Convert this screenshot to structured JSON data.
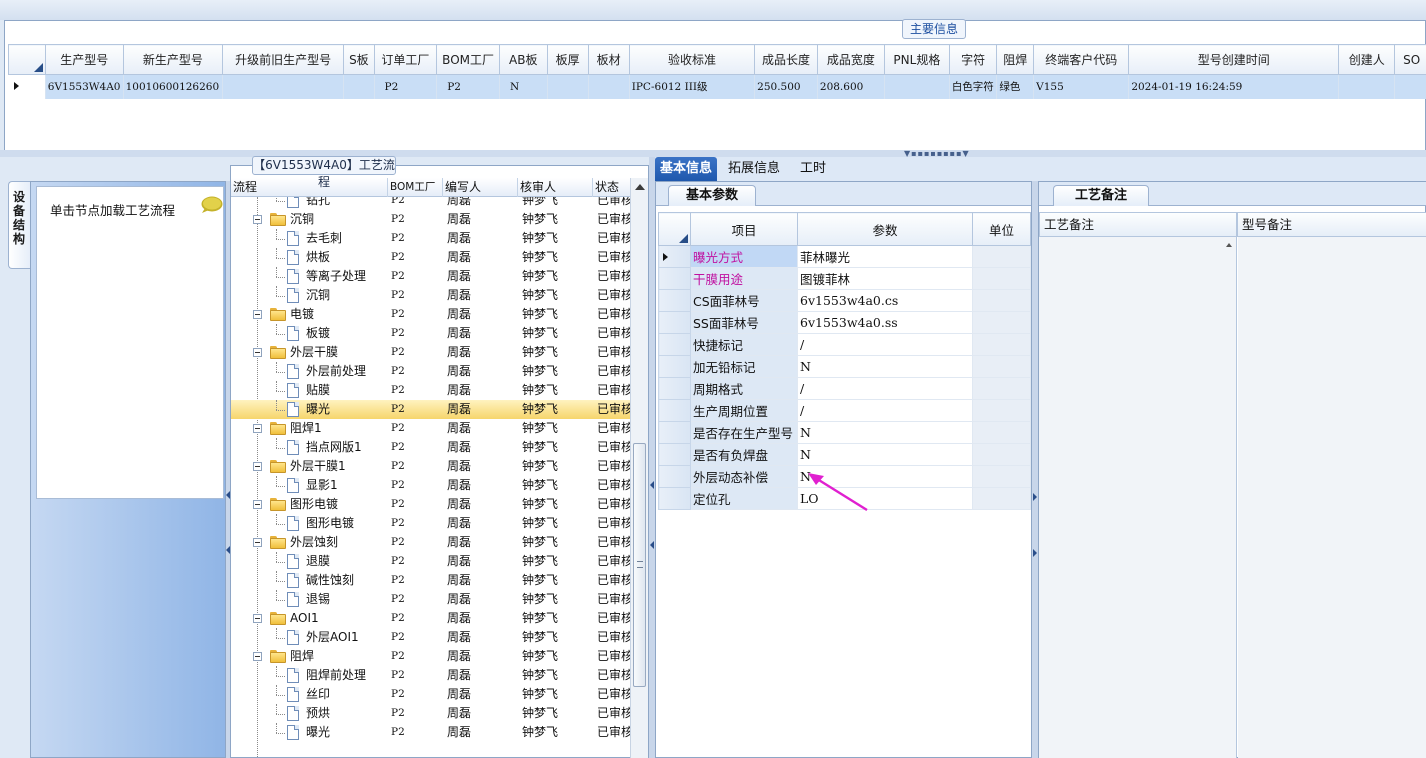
{
  "main_info": {
    "title": "主要信息",
    "columns": [
      "生产型号",
      "新生产型号",
      "升级前旧生产型号",
      "S板",
      "订单工厂",
      "BOM工厂",
      "AB板",
      "板厚",
      "板材",
      "验收标准",
      "成品长度",
      "成品宽度",
      "PNL规格",
      "字符",
      "阻焊",
      "终端客户代码",
      "型号创建时间",
      "创建人",
      "SO"
    ],
    "row": [
      "6V1553W4A0",
      "10010600126260",
      "",
      "",
      "P2",
      "P2",
      "N",
      "",
      "",
      "IPC-6012 III级",
      "250.500",
      "208.600",
      "",
      "白色字符",
      "绿色",
      "V155",
      "2024-01-19 16:24:59",
      "",
      ""
    ]
  },
  "left": {
    "vertical_tab": "设备结构",
    "hint": "单击节点加载工艺流程"
  },
  "process": {
    "title": "【6V1553W4A0】工艺流程",
    "columns": [
      "流程",
      "BOM工厂",
      "编写人",
      "核审人",
      "状态"
    ],
    "first_row_label": "钻孔",
    "rows": [
      {
        "name": "钻孔",
        "level": 2,
        "bom": "P2",
        "author": "周磊",
        "reviewer": "钟梦飞",
        "status": "已审核"
      },
      {
        "name": "沉铜",
        "level": 1,
        "bom": "P2",
        "author": "周磊",
        "reviewer": "钟梦飞",
        "status": "已审核"
      },
      {
        "name": "去毛刺",
        "level": 2,
        "bom": "P2",
        "author": "周磊",
        "reviewer": "钟梦飞",
        "status": "已审核"
      },
      {
        "name": "烘板",
        "level": 2,
        "bom": "P2",
        "author": "周磊",
        "reviewer": "钟梦飞",
        "status": "已审核"
      },
      {
        "name": "等离子处理",
        "level": 2,
        "bom": "P2",
        "author": "周磊",
        "reviewer": "钟梦飞",
        "status": "已审核"
      },
      {
        "name": "沉铜",
        "level": 2,
        "bom": "P2",
        "author": "周磊",
        "reviewer": "钟梦飞",
        "status": "已审核"
      },
      {
        "name": "电镀",
        "level": 1,
        "bom": "P2",
        "author": "周磊",
        "reviewer": "钟梦飞",
        "status": "已审核"
      },
      {
        "name": "板镀",
        "level": 2,
        "bom": "P2",
        "author": "周磊",
        "reviewer": "钟梦飞",
        "status": "已审核"
      },
      {
        "name": "外层干膜",
        "level": 1,
        "bom": "P2",
        "author": "周磊",
        "reviewer": "钟梦飞",
        "status": "已审核"
      },
      {
        "name": "外层前处理",
        "level": 2,
        "bom": "P2",
        "author": "周磊",
        "reviewer": "钟梦飞",
        "status": "已审核"
      },
      {
        "name": "贴膜",
        "level": 2,
        "bom": "P2",
        "author": "周磊",
        "reviewer": "钟梦飞",
        "status": "已审核"
      },
      {
        "name": "曝光",
        "level": 2,
        "bom": "P2",
        "author": "周磊",
        "reviewer": "钟梦飞",
        "status": "已审核",
        "selected": true
      },
      {
        "name": "阻焊1",
        "level": 1,
        "bom": "P2",
        "author": "周磊",
        "reviewer": "钟梦飞",
        "status": "已审核"
      },
      {
        "name": "挡点网版1",
        "level": 2,
        "bom": "P2",
        "author": "周磊",
        "reviewer": "钟梦飞",
        "status": "已审核"
      },
      {
        "name": "外层干膜1",
        "level": 1,
        "bom": "P2",
        "author": "周磊",
        "reviewer": "钟梦飞",
        "status": "已审核"
      },
      {
        "name": "显影1",
        "level": 2,
        "bom": "P2",
        "author": "周磊",
        "reviewer": "钟梦飞",
        "status": "已审核"
      },
      {
        "name": "图形电镀",
        "level": 1,
        "bom": "P2",
        "author": "周磊",
        "reviewer": "钟梦飞",
        "status": "已审核"
      },
      {
        "name": "图形电镀",
        "level": 2,
        "bom": "P2",
        "author": "周磊",
        "reviewer": "钟梦飞",
        "status": "已审核"
      },
      {
        "name": "外层蚀刻",
        "level": 1,
        "bom": "P2",
        "author": "周磊",
        "reviewer": "钟梦飞",
        "status": "已审核"
      },
      {
        "name": "退膜",
        "level": 2,
        "bom": "P2",
        "author": "周磊",
        "reviewer": "钟梦飞",
        "status": "已审核"
      },
      {
        "name": "碱性蚀刻",
        "level": 2,
        "bom": "P2",
        "author": "周磊",
        "reviewer": "钟梦飞",
        "status": "已审核"
      },
      {
        "name": "退锡",
        "level": 2,
        "bom": "P2",
        "author": "周磊",
        "reviewer": "钟梦飞",
        "status": "已审核"
      },
      {
        "name": "AOI1",
        "level": 1,
        "bom": "P2",
        "author": "周磊",
        "reviewer": "钟梦飞",
        "status": "已审核"
      },
      {
        "name": "外层AOI1",
        "level": 2,
        "bom": "P2",
        "author": "周磊",
        "reviewer": "钟梦飞",
        "status": "已审核"
      },
      {
        "name": "阻焊",
        "level": 1,
        "bom": "P2",
        "author": "周磊",
        "reviewer": "钟梦飞",
        "status": "已审核"
      },
      {
        "name": "阻焊前处理",
        "level": 2,
        "bom": "P2",
        "author": "周磊",
        "reviewer": "钟梦飞",
        "status": "已审核"
      },
      {
        "name": "丝印",
        "level": 2,
        "bom": "P2",
        "author": "周磊",
        "reviewer": "钟梦飞",
        "status": "已审核"
      },
      {
        "name": "预烘",
        "level": 2,
        "bom": "P2",
        "author": "周磊",
        "reviewer": "钟梦飞",
        "status": "已审核"
      },
      {
        "name": "曝光",
        "level": 2,
        "bom": "P2",
        "author": "周磊",
        "reviewer": "钟梦飞",
        "status": "已审核"
      }
    ]
  },
  "top_tabs": [
    "基本信息",
    "拓展信息",
    "工时"
  ],
  "basic_params": {
    "tab": "基本参数",
    "columns": [
      "项目",
      "参数",
      "单位"
    ],
    "rows": [
      {
        "item": "曝光方式",
        "value": "菲林曝光",
        "unit": "",
        "highlight": true
      },
      {
        "item": "干膜用途",
        "value": "图镀菲林",
        "unit": "",
        "highlight": true
      },
      {
        "item": "CS面菲林号",
        "value": "6v1553w4a0.cs",
        "unit": ""
      },
      {
        "item": "SS面菲林号",
        "value": "6v1553w4a0.ss",
        "unit": ""
      },
      {
        "item": "快捷标记",
        "value": "/",
        "unit": ""
      },
      {
        "item": "加无铅标记",
        "value": "N",
        "unit": ""
      },
      {
        "item": "周期格式",
        "value": "/",
        "unit": ""
      },
      {
        "item": "生产周期位置",
        "value": "/",
        "unit": ""
      },
      {
        "item": "是否存在生产型号",
        "value": "N",
        "unit": ""
      },
      {
        "item": "是否有负焊盘",
        "value": "N",
        "unit": ""
      },
      {
        "item": "外层动态补偿",
        "value": "N",
        "unit": ""
      },
      {
        "item": "定位孔",
        "value": "LO",
        "unit": ""
      }
    ]
  },
  "remarks": {
    "tab": "工艺备注",
    "process_remark_header": "工艺备注",
    "model_remark_header": "型号备注"
  },
  "colors": {
    "accent": "#1f58ad",
    "selection": "#c9def6",
    "highlight_text": "#c010a0",
    "annotation_arrow": "#e020d0"
  }
}
